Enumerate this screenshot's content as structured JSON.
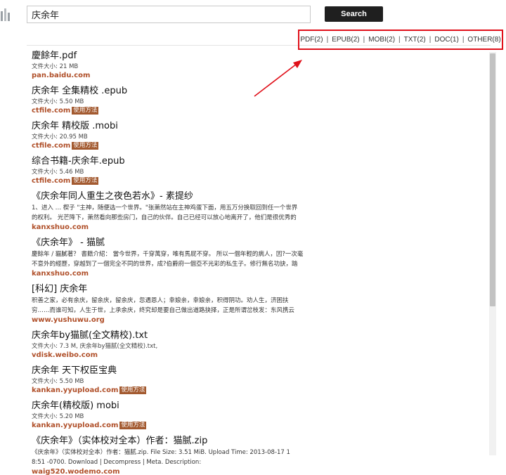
{
  "search": {
    "value": "庆余年",
    "button_label": "Search"
  },
  "filters": [
    {
      "label": "PDF(2)"
    },
    {
      "label": "EPUB(2)"
    },
    {
      "label": "MOBI(2)"
    },
    {
      "label": "TXT(2)"
    },
    {
      "label": "DOC(1)"
    },
    {
      "label": "OTHER(8)"
    }
  ],
  "filter_separator": "|",
  "annotation": {
    "color": "#e0101a"
  },
  "results": [
    {
      "title": "慶餘年.pdf",
      "meta": "文件大小: 21 MB",
      "source": "pan.baidu.com",
      "tag": ""
    },
    {
      "title": "庆余年 全集精校 .epub",
      "meta": "文件大小: 5.50 MB",
      "source": "ctfile.com",
      "tag": "使用方法"
    },
    {
      "title": "庆余年 精校版 .mobi",
      "meta": "文件大小: 20.95 MB",
      "source": "ctfile.com",
      "tag": "使用方法"
    },
    {
      "title": "综合书籍-庆余年.epub",
      "meta": "文件大小: 5.46 MB",
      "source": "ctfile.com",
      "tag": "使用方法"
    },
    {
      "title": "《庆余年同人重生之夜色若水》- 素提纱",
      "snippet": [
        "1、进入 … 楔子 \"主神，随便选一个世界。\"张萧然站在主神鸡蛋下面，用五万分换取回到任一个世界",
        "的权利。 光芒降下，萧然看向那些房门，自己的伙伴。自己已经可以放心地离开了，他们是很优秀的"
      ],
      "source": "kanxshuo.com",
      "tag": ""
    },
    {
      "title": "《庆余年》 - 猫腻",
      "snippet": [
        "慶餘年 / 貓膩著？ 書籍介紹：  當今世界，千穿萬穿，唯有馬屁不穿。 所以一個年輕的病人，因?一次毫",
        "不意外的經歷，穿越到了一個完全不同的世界，成?伯爵府一個亞不光彩的私生子。修行無名功訣，踏"
      ],
      "source": "kanxshuo.com",
      "tag": ""
    },
    {
      "title": "[科幻] 庆余年",
      "snippet": [
        "积善之家，必有余庆，留余庆，留余庆，忽遇恩人；幸娘亲，幸娘亲，积得阴功。劝人生，济困扶",
        "穷……而谁可知，人生于世，上承余庆，终究却是要自己做出道路抉择，正是所谓岔枝发：东风携云"
      ],
      "source": "www.yushuwu.org",
      "tag": ""
    },
    {
      "title": "庆余年by猫腻(全文精校).txt",
      "meta": "文件大小: 7.3 M, 庆余年by猫腻(全文精校).txt,",
      "source": "vdisk.weibo.com",
      "tag": ""
    },
    {
      "title": "庆余年 天下权臣宝典",
      "meta": "文件大小: 5.50 MB",
      "source": "kankan.yyupload.com",
      "tag": "使用方法"
    },
    {
      "title": "庆余年(精校版) mobi",
      "meta": "文件大小: 5.20 MB",
      "source": "kankan.yyupload.com",
      "tag": "使用方法"
    },
    {
      "title": "《庆余年》（实体校对全本）作者：猫腻.zip",
      "snippet": [
        "《庆余年》（实体校对全本）作者：猫腻.zip. File Size: 3.51 MiB. Upload Time: 2013-08-17 1",
        "8:51 -0700. Download | Decompress | Meta. Description:"
      ],
      "source": "waig520.wodemo.com",
      "tag": ""
    }
  ]
}
